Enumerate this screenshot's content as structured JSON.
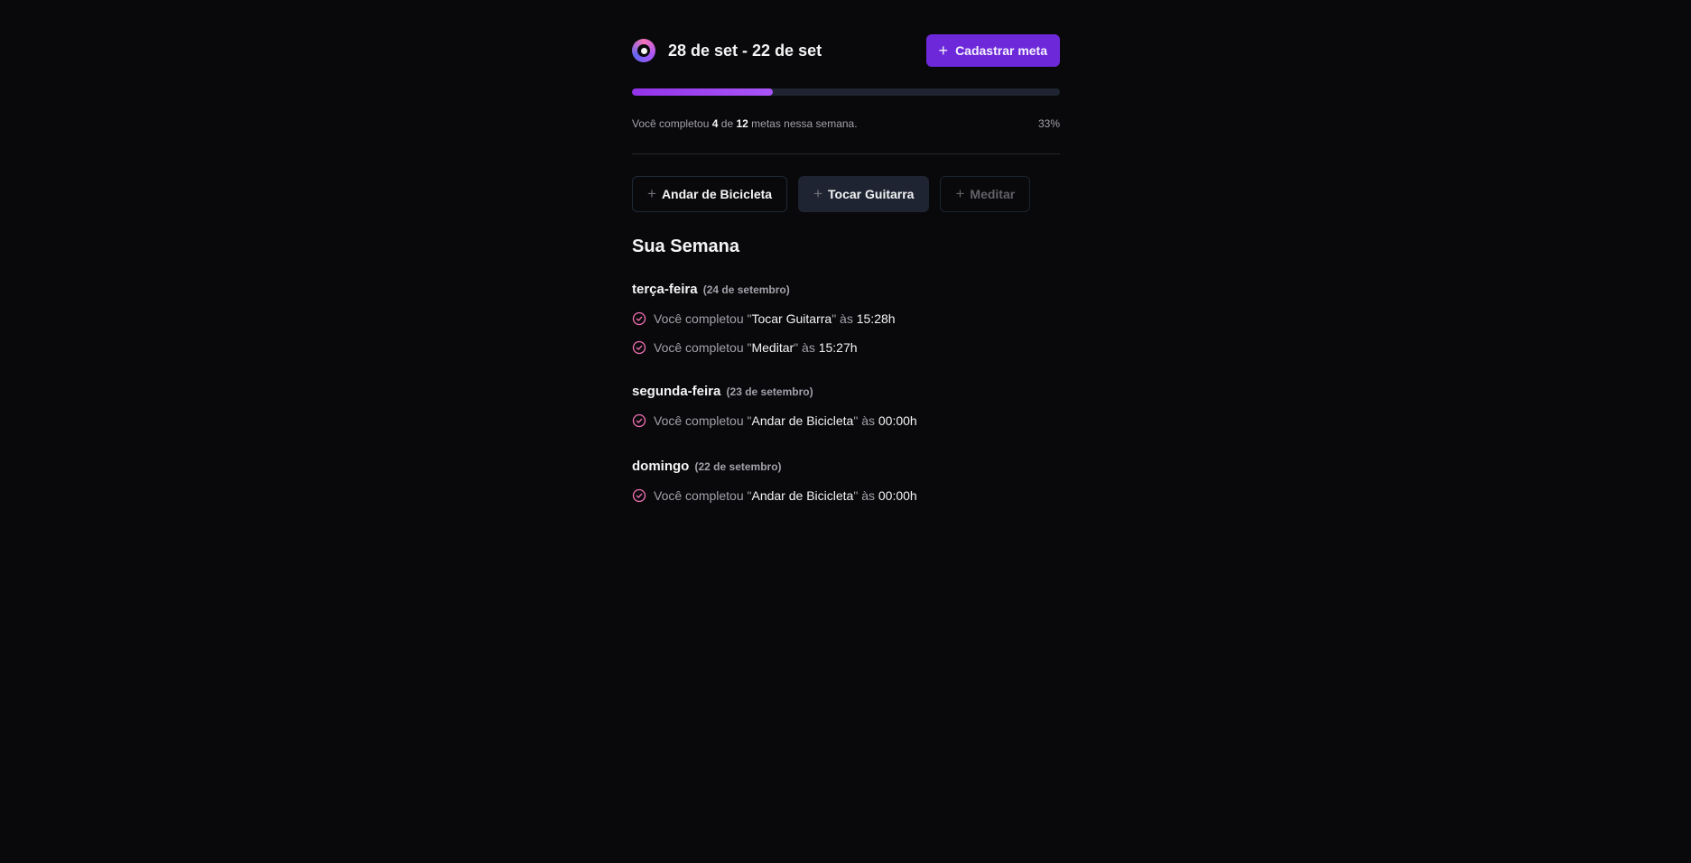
{
  "header": {
    "title": "28 de set - 22 de set",
    "cta_label": "Cadastrar meta"
  },
  "progress": {
    "completed": "4",
    "total": "12",
    "percent_label": "33%",
    "fraction": 0.33,
    "text_before": "Você completou",
    "text_middle": "de",
    "text_after": "metas nessa semana."
  },
  "goals": [
    {
      "label": "Andar de Bicicleta",
      "state": "outline"
    },
    {
      "label": "Tocar Guitarra",
      "state": "filled"
    },
    {
      "label": "Meditar",
      "state": "disabled"
    }
  ],
  "week": {
    "title": "Sua Semana",
    "days": [
      {
        "name": "terça-feira",
        "date": "(24 de setembro)",
        "entries": [
          {
            "prefix": "Você completou \"",
            "goal": "Tocar Guitarra",
            "mid": "\" às ",
            "time": "15:28h"
          },
          {
            "prefix": "Você completou \"",
            "goal": "Meditar",
            "mid": "\" às ",
            "time": "15:27h"
          }
        ]
      },
      {
        "name": "segunda-feira",
        "date": "(23 de setembro)",
        "entries": [
          {
            "prefix": "Você completou \"",
            "goal": "Andar de Bicicleta",
            "mid": "\" às ",
            "time": "00:00h"
          }
        ]
      },
      {
        "name": "domingo",
        "date": "(22 de setembro)",
        "entries": [
          {
            "prefix": "Você completou \"",
            "goal": "Andar de Bicicleta",
            "mid": "\" às ",
            "time": "00:00h"
          }
        ]
      }
    ]
  },
  "colors": {
    "accent": "#6d28d9",
    "progress": "#a855f7",
    "check": "#f472b6",
    "background": "#09090b"
  },
  "icons": {
    "logo": "target-logo-icon",
    "plus": "plus-icon",
    "check": "circle-check-icon"
  }
}
